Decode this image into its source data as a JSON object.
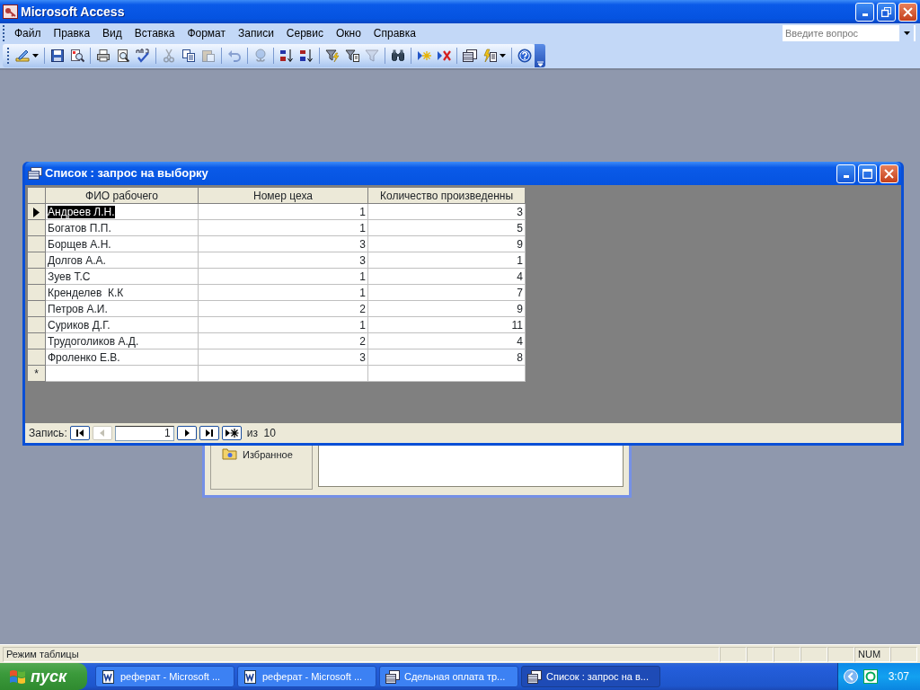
{
  "window": {
    "title": "Microsoft Access"
  },
  "menu": [
    "Файл",
    "Правка",
    "Вид",
    "Вставка",
    "Формат",
    "Записи",
    "Сервис",
    "Окно",
    "Справка"
  ],
  "help_search": {
    "placeholder": "Введите вопрос"
  },
  "toolbar": [
    [
      {
        "kind": "view",
        "disabled": false,
        "menu": true
      }
    ],
    [
      {
        "kind": "save",
        "disabled": false,
        "menu": false
      },
      {
        "kind": "filesearch",
        "disabled": false,
        "menu": false
      }
    ],
    [
      {
        "kind": "print",
        "disabled": false,
        "menu": false
      },
      {
        "kind": "preview",
        "disabled": false,
        "menu": false
      },
      {
        "kind": "spell",
        "disabled": false,
        "menu": false
      }
    ],
    [
      {
        "kind": "cut",
        "disabled": true,
        "menu": false
      },
      {
        "kind": "copy",
        "disabled": false,
        "menu": false
      },
      {
        "kind": "paste",
        "disabled": true,
        "menu": false
      }
    ],
    [
      {
        "kind": "undo",
        "disabled": true,
        "menu": false
      }
    ],
    [
      {
        "kind": "link",
        "disabled": true,
        "menu": false
      }
    ],
    [
      {
        "kind": "sortasc",
        "disabled": false,
        "menu": false
      },
      {
        "kind": "sortdesc",
        "disabled": false,
        "menu": false
      }
    ],
    [
      {
        "kind": "filtersel",
        "disabled": false,
        "menu": false
      },
      {
        "kind": "filterform",
        "disabled": false,
        "menu": false
      },
      {
        "kind": "filter",
        "disabled": true,
        "menu": false
      }
    ],
    [
      {
        "kind": "find",
        "disabled": false,
        "menu": false
      }
    ],
    [
      {
        "kind": "newrec",
        "disabled": false,
        "menu": false
      },
      {
        "kind": "delrec",
        "disabled": false,
        "menu": false
      }
    ],
    [
      {
        "kind": "dbwindow",
        "disabled": false,
        "menu": false
      },
      {
        "kind": "newobject",
        "disabled": false,
        "menu": true
      }
    ],
    [
      {
        "kind": "help",
        "disabled": false,
        "menu": false
      }
    ]
  ],
  "query_window": {
    "title": "Список : запрос на выборку",
    "columns": [
      "ФИО рабочего",
      "Номер цеха",
      "Количество произведенны"
    ],
    "rows": [
      {
        "selected": true,
        "cells": [
          "Андреев Л.Н.",
          "1",
          "3"
        ]
      },
      {
        "selected": false,
        "cells": [
          "Богатов П.П.",
          "1",
          "5"
        ]
      },
      {
        "selected": false,
        "cells": [
          "Борщев А.Н.",
          "3",
          "9"
        ]
      },
      {
        "selected": false,
        "cells": [
          "Долгов А.А.",
          "3",
          "1"
        ]
      },
      {
        "selected": false,
        "cells": [
          "Зуев Т.С",
          "1",
          "4"
        ]
      },
      {
        "selected": false,
        "cells": [
          "Кренделев  К.К",
          "1",
          "7"
        ]
      },
      {
        "selected": false,
        "cells": [
          "Петров А.И.",
          "2",
          "9"
        ]
      },
      {
        "selected": false,
        "cells": [
          "Суриков Д.Г.",
          "1",
          "11"
        ]
      },
      {
        "selected": false,
        "cells": [
          "Трудоголиков А.Д.",
          "2",
          "4"
        ]
      },
      {
        "selected": false,
        "cells": [
          "Фроленко Е.В.",
          "3",
          "8"
        ]
      }
    ],
    "new_row_marker": "*",
    "navigator": {
      "label": "Запись:",
      "current": "1",
      "total": "из  10"
    }
  },
  "database_window": {
    "groups": [
      "Избранное"
    ]
  },
  "status_bar": {
    "text": "Режим таблицы",
    "indicators": [
      "NUM"
    ]
  },
  "taskbar": {
    "start": "пуск",
    "tasks": [
      {
        "label": "реферат - Microsoft ...",
        "kind": "word",
        "selected": false
      },
      {
        "label": "реферат - Microsoft ...",
        "kind": "word",
        "selected": false
      },
      {
        "label": "Сдельная оплата тр...",
        "kind": "access",
        "selected": false
      },
      {
        "label": "Список : запрос на в...",
        "kind": "access",
        "selected": true
      }
    ],
    "clock": "3:07"
  }
}
